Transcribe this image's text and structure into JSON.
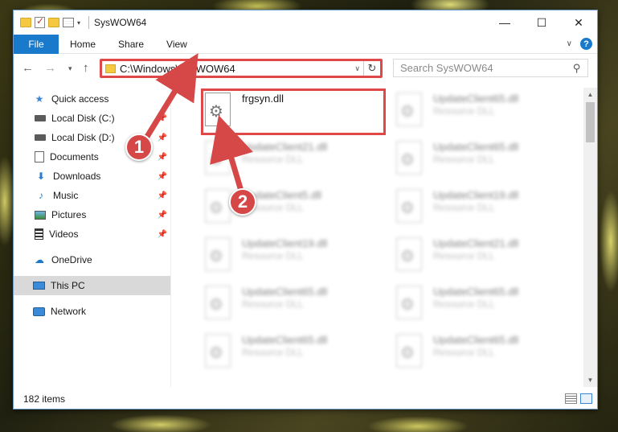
{
  "window": {
    "title": "SysWOW64",
    "controls": {
      "minimize": "—",
      "maximize": "☐",
      "close": "✕"
    }
  },
  "ribbon": {
    "tabs": [
      "File",
      "Home",
      "Share",
      "View"
    ],
    "help": "?"
  },
  "address": {
    "path": "C:\\Windows\\SysWOW64",
    "search_placeholder": "Search SysWOW64"
  },
  "nav": {
    "items": [
      {
        "label": "Quick access",
        "icon": "star-icon"
      },
      {
        "label": "Local Disk (C:)",
        "icon": "drive-icon",
        "pinned": true
      },
      {
        "label": "Local Disk (D:)",
        "icon": "drive-icon",
        "pinned": true
      },
      {
        "label": "Documents",
        "icon": "document-icon",
        "pinned": true
      },
      {
        "label": "Downloads",
        "icon": "download-icon",
        "pinned": true
      },
      {
        "label": "Music",
        "icon": "music-icon",
        "pinned": true
      },
      {
        "label": "Pictures",
        "icon": "picture-icon",
        "pinned": true
      },
      {
        "label": "Videos",
        "icon": "video-icon",
        "pinned": true
      },
      {
        "label": "OneDrive",
        "icon": "cloud-icon"
      },
      {
        "label": "This PC",
        "icon": "computer-icon",
        "selected": true
      },
      {
        "label": "Network",
        "icon": "network-icon"
      }
    ]
  },
  "files": {
    "highlighted": {
      "name": "frgsyn.dll",
      "type": ""
    },
    "right_column": [
      {
        "name": "UpdateClient65.dll",
        "type": "Resource DLL"
      },
      {
        "name": "UpdateClient65.dll",
        "type": "Resource DLL"
      },
      {
        "name": "UpdateClient19.dll",
        "type": "Resource DLL"
      },
      {
        "name": "UpdateClient21.dll",
        "type": "Resource DLL"
      },
      {
        "name": "UpdateClient65.dll",
        "type": "Resource DLL"
      },
      {
        "name": "UpdateClient65.dll",
        "type": "Resource DLL"
      }
    ],
    "left_column": [
      {
        "name": "UpdateClient21.dll",
        "type": "Resource DLL"
      },
      {
        "name": "UpdateClient5.dll",
        "type": "Resource DLL"
      },
      {
        "name": "UpdateClient19.dll",
        "type": "Resource DLL"
      },
      {
        "name": "UpdateClient65.dll",
        "type": "Resource DLL"
      },
      {
        "name": "UpdateClient65.dll",
        "type": "Resource DLL"
      }
    ]
  },
  "status": {
    "item_count": "182 items"
  },
  "annotations": {
    "step1": "1",
    "step2": "2",
    "accent": "#d64848"
  }
}
